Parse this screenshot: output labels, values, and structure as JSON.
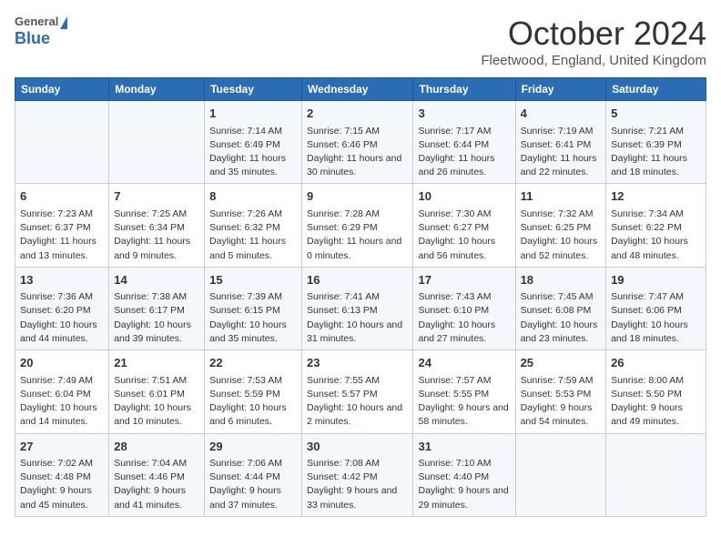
{
  "header": {
    "logo_general": "General",
    "logo_blue": "Blue",
    "title": "October 2024",
    "subtitle": "Fleetwood, England, United Kingdom"
  },
  "days_of_week": [
    "Sunday",
    "Monday",
    "Tuesday",
    "Wednesday",
    "Thursday",
    "Friday",
    "Saturday"
  ],
  "weeks": [
    [
      {
        "day": "",
        "info": ""
      },
      {
        "day": "",
        "info": ""
      },
      {
        "day": "1",
        "info": "Sunrise: 7:14 AM\nSunset: 6:49 PM\nDaylight: 11 hours and 35 minutes."
      },
      {
        "day": "2",
        "info": "Sunrise: 7:15 AM\nSunset: 6:46 PM\nDaylight: 11 hours and 30 minutes."
      },
      {
        "day": "3",
        "info": "Sunrise: 7:17 AM\nSunset: 6:44 PM\nDaylight: 11 hours and 26 minutes."
      },
      {
        "day": "4",
        "info": "Sunrise: 7:19 AM\nSunset: 6:41 PM\nDaylight: 11 hours and 22 minutes."
      },
      {
        "day": "5",
        "info": "Sunrise: 7:21 AM\nSunset: 6:39 PM\nDaylight: 11 hours and 18 minutes."
      }
    ],
    [
      {
        "day": "6",
        "info": "Sunrise: 7:23 AM\nSunset: 6:37 PM\nDaylight: 11 hours and 13 minutes."
      },
      {
        "day": "7",
        "info": "Sunrise: 7:25 AM\nSunset: 6:34 PM\nDaylight: 11 hours and 9 minutes."
      },
      {
        "day": "8",
        "info": "Sunrise: 7:26 AM\nSunset: 6:32 PM\nDaylight: 11 hours and 5 minutes."
      },
      {
        "day": "9",
        "info": "Sunrise: 7:28 AM\nSunset: 6:29 PM\nDaylight: 11 hours and 0 minutes."
      },
      {
        "day": "10",
        "info": "Sunrise: 7:30 AM\nSunset: 6:27 PM\nDaylight: 10 hours and 56 minutes."
      },
      {
        "day": "11",
        "info": "Sunrise: 7:32 AM\nSunset: 6:25 PM\nDaylight: 10 hours and 52 minutes."
      },
      {
        "day": "12",
        "info": "Sunrise: 7:34 AM\nSunset: 6:22 PM\nDaylight: 10 hours and 48 minutes."
      }
    ],
    [
      {
        "day": "13",
        "info": "Sunrise: 7:36 AM\nSunset: 6:20 PM\nDaylight: 10 hours and 44 minutes."
      },
      {
        "day": "14",
        "info": "Sunrise: 7:38 AM\nSunset: 6:17 PM\nDaylight: 10 hours and 39 minutes."
      },
      {
        "day": "15",
        "info": "Sunrise: 7:39 AM\nSunset: 6:15 PM\nDaylight: 10 hours and 35 minutes."
      },
      {
        "day": "16",
        "info": "Sunrise: 7:41 AM\nSunset: 6:13 PM\nDaylight: 10 hours and 31 minutes."
      },
      {
        "day": "17",
        "info": "Sunrise: 7:43 AM\nSunset: 6:10 PM\nDaylight: 10 hours and 27 minutes."
      },
      {
        "day": "18",
        "info": "Sunrise: 7:45 AM\nSunset: 6:08 PM\nDaylight: 10 hours and 23 minutes."
      },
      {
        "day": "19",
        "info": "Sunrise: 7:47 AM\nSunset: 6:06 PM\nDaylight: 10 hours and 18 minutes."
      }
    ],
    [
      {
        "day": "20",
        "info": "Sunrise: 7:49 AM\nSunset: 6:04 PM\nDaylight: 10 hours and 14 minutes."
      },
      {
        "day": "21",
        "info": "Sunrise: 7:51 AM\nSunset: 6:01 PM\nDaylight: 10 hours and 10 minutes."
      },
      {
        "day": "22",
        "info": "Sunrise: 7:53 AM\nSunset: 5:59 PM\nDaylight: 10 hours and 6 minutes."
      },
      {
        "day": "23",
        "info": "Sunrise: 7:55 AM\nSunset: 5:57 PM\nDaylight: 10 hours and 2 minutes."
      },
      {
        "day": "24",
        "info": "Sunrise: 7:57 AM\nSunset: 5:55 PM\nDaylight: 9 hours and 58 minutes."
      },
      {
        "day": "25",
        "info": "Sunrise: 7:59 AM\nSunset: 5:53 PM\nDaylight: 9 hours and 54 minutes."
      },
      {
        "day": "26",
        "info": "Sunrise: 8:00 AM\nSunset: 5:50 PM\nDaylight: 9 hours and 49 minutes."
      }
    ],
    [
      {
        "day": "27",
        "info": "Sunrise: 7:02 AM\nSunset: 4:48 PM\nDaylight: 9 hours and 45 minutes."
      },
      {
        "day": "28",
        "info": "Sunrise: 7:04 AM\nSunset: 4:46 PM\nDaylight: 9 hours and 41 minutes."
      },
      {
        "day": "29",
        "info": "Sunrise: 7:06 AM\nSunset: 4:44 PM\nDaylight: 9 hours and 37 minutes."
      },
      {
        "day": "30",
        "info": "Sunrise: 7:08 AM\nSunset: 4:42 PM\nDaylight: 9 hours and 33 minutes."
      },
      {
        "day": "31",
        "info": "Sunrise: 7:10 AM\nSunset: 4:40 PM\nDaylight: 9 hours and 29 minutes."
      },
      {
        "day": "",
        "info": ""
      },
      {
        "day": "",
        "info": ""
      }
    ]
  ]
}
